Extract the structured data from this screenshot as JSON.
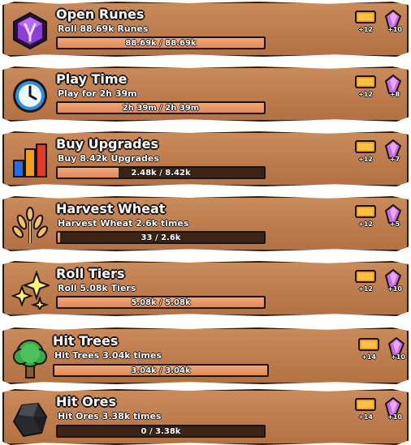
{
  "quests": [
    {
      "title": "Open Runes",
      "desc": "Roll 88.69k Runes",
      "progress_text": "88.69k / 88.69k",
      "progress": 1.0,
      "icon": "purple-rune-icon",
      "reward_ticket": "+12",
      "reward_gem": "+10"
    },
    {
      "title": "Play Time",
      "desc": "Play for 2h 39m",
      "progress_text": "2h 39m / 2h 39m",
      "progress": 1.0,
      "icon": "clock-icon",
      "reward_ticket": "+12",
      "reward_gem": "+8"
    },
    {
      "title": "Buy Upgrades",
      "desc": "Buy 8.42k Upgrades",
      "progress_text": "2.48k / 8.42k",
      "progress": 0.2945,
      "icon": "bar-graph-icon",
      "reward_ticket": "+12",
      "reward_gem": "+7"
    },
    {
      "title": "Harvest Wheat",
      "desc": "Harvest Wheat 2.6k times",
      "progress_text": "33 / 2.6k",
      "progress": 0.0127,
      "icon": "wheat-icon",
      "reward_ticket": "+12",
      "reward_gem": "+5"
    },
    {
      "title": "Roll Tiers",
      "desc": "Roll 5.08k Tiers",
      "progress_text": "5.08k / 5.08k",
      "progress": 1.0,
      "icon": "sparkles-icon",
      "reward_ticket": "+12",
      "reward_gem": "+10"
    },
    {
      "title": "Hit Trees",
      "desc": "Hit Trees 3.04k times",
      "progress_text": "3.04k / 3.04k",
      "progress": 1.0,
      "icon": "tree-icon",
      "reward_ticket": "+14",
      "reward_gem": "+10"
    },
    {
      "title": "Hit Ores",
      "desc": "Hit Ores 3.38k times",
      "progress_text": "0 / 3.38k",
      "progress": 0.0,
      "icon": "ore-icon",
      "reward_ticket": "+14",
      "reward_gem": "+10"
    }
  ],
  "colors": {
    "panel": "#c0804f",
    "bar_fill": "#e89a68",
    "bar_bg": "#3a2418",
    "ticket": "#f4a21a",
    "gem": "#c86be0"
  }
}
